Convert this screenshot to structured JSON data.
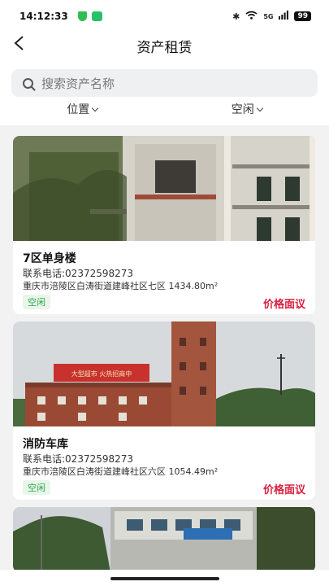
{
  "status_bar": {
    "time": "14:12:33",
    "battery": "99",
    "signal": "5G"
  },
  "header": {
    "title": "资产租赁"
  },
  "search": {
    "placeholder": "搜索资产名称"
  },
  "filters": [
    {
      "label": "位置"
    },
    {
      "label": "空闲"
    }
  ],
  "assets": [
    {
      "name": "7区单身楼",
      "phone": "联系电话:02372598273",
      "address": "重庆市涪陵区白涛街道建峰社区七区",
      "area": "1434.80m²",
      "status": "空闲",
      "price": "价格面议"
    },
    {
      "name": "消防车库",
      "phone": "联系电话:02372598273",
      "address": "重庆市涪陵区白涛街道建峰社区六区",
      "area": "1054.49m²",
      "status": "空闲",
      "price": "价格面议"
    },
    {
      "banner_text": "大型超市 火热招商中"
    }
  ],
  "colors": {
    "accent_red": "#d81e3e",
    "tag_green": "#2aa44a"
  }
}
